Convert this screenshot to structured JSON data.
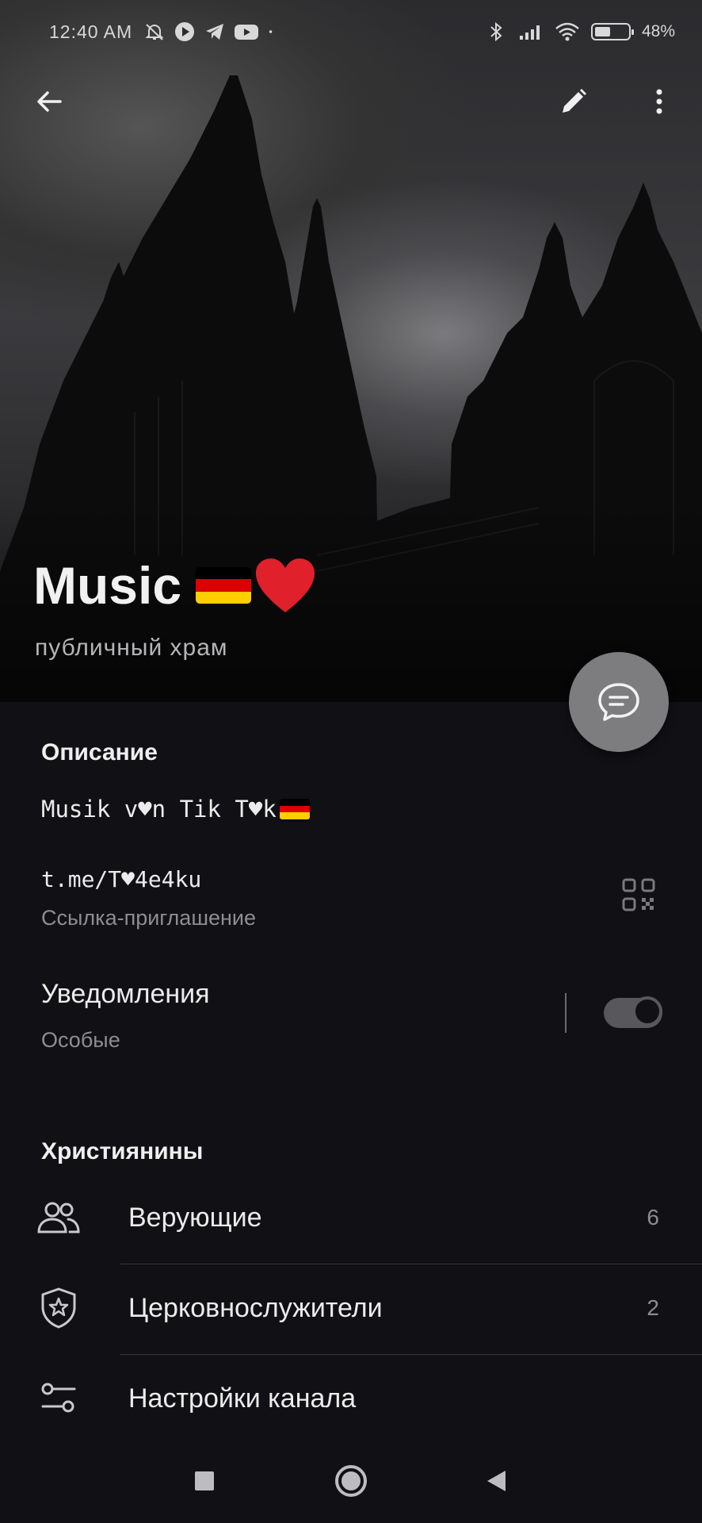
{
  "status_bar": {
    "time": "12:40 AM",
    "battery": "48%",
    "battery_level": 0.48,
    "icons": [
      "silent-bell-icon",
      "play-icon",
      "telegram-icon",
      "youtube-icon",
      "dot-icon",
      "bluetooth-icon",
      "signal-icon",
      "wifi-icon",
      "battery-icon"
    ]
  },
  "toolbar": {
    "back_icon": "arrow-left-icon",
    "edit_icon": "pencil-icon",
    "more_icon": "more-vertical-icon"
  },
  "channel": {
    "name": "Music",
    "emoji": [
      "german-flag",
      "red-heart"
    ],
    "subtitle": "публичный храм"
  },
  "fab": {
    "icon": "message-bubble-icon"
  },
  "info": {
    "description_header": "Описание",
    "description_text": "Musik v♥n Tik T♥k",
    "description_emoji": "german-flag",
    "link": "t.me/T♥4e4ku",
    "link_caption": "Ссылка-приглашение",
    "qr_icon": "qr-code-icon",
    "notifications_label": "Уведомления",
    "notifications_value": "Особые",
    "notifications_enabled": true
  },
  "members_section": {
    "header": "Християнины",
    "rows": [
      {
        "label": "Верующие",
        "count": "6",
        "icon": "people-icon"
      },
      {
        "label": "Церковнослужители",
        "count": "2",
        "icon": "shield-star-icon"
      },
      {
        "label": "Настройки канала",
        "count": "",
        "icon": "sliders-icon"
      }
    ]
  },
  "colors": {
    "background": "#111014",
    "fab": "#7d7d7f",
    "flag_black": "#000000",
    "flag_red": "#dd0000",
    "flag_gold": "#ffce00",
    "heart": "#e0202a"
  },
  "nav_bar": [
    "recent-apps-square-icon",
    "home-circle-icon",
    "back-triangle-icon"
  ]
}
